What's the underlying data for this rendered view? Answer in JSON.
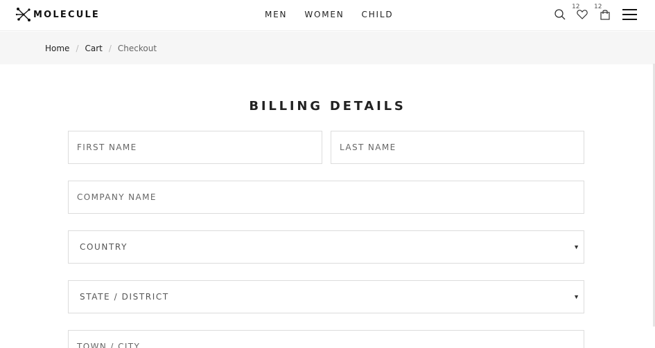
{
  "brand": {
    "name": "MOLECULE",
    "logo_icon": "molecule-icon"
  },
  "nav": {
    "items": [
      "MEN",
      "WOMEN",
      "CHILD"
    ]
  },
  "header_icons": {
    "search": "search-icon",
    "wishlist": {
      "icon": "heart-icon",
      "count": "12"
    },
    "cart": {
      "icon": "bag-icon",
      "count": "12"
    },
    "menu": "hamburger-icon"
  },
  "breadcrumb": {
    "home": "Home",
    "cart": "Cart",
    "current": "Checkout",
    "separator": "/"
  },
  "form": {
    "title": "BILLING DETAILS",
    "first_name_placeholder": "FIRST NAME",
    "last_name_placeholder": "LAST NAME",
    "company_placeholder": "COMPANY NAME",
    "country_value": "COUNTRY",
    "state_value": "STATE / DISTRICT",
    "town_placeholder": "TOWN / CITY"
  },
  "colors": {
    "accent": "#111111",
    "breadcrumb_bg": "#f6f6f6",
    "border": "#dcdcdc"
  }
}
